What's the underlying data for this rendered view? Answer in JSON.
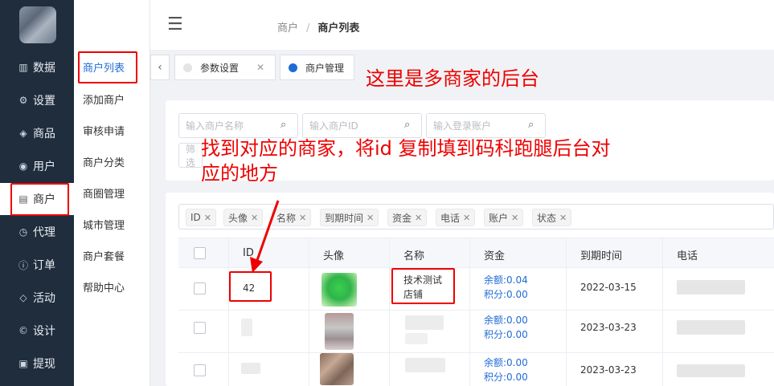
{
  "nav": {
    "items": [
      {
        "label": "数据",
        "icon": "bar-chart-icon"
      },
      {
        "label": "设置",
        "icon": "gear-icon"
      },
      {
        "label": "商品",
        "icon": "cube-icon"
      },
      {
        "label": "用户",
        "icon": "user-icon"
      },
      {
        "label": "商户",
        "icon": "list-icon"
      },
      {
        "label": "代理",
        "icon": "clock-icon"
      },
      {
        "label": "订单",
        "icon": "info-icon"
      },
      {
        "label": "活动",
        "icon": "tag-icon"
      },
      {
        "label": "设计",
        "icon": "copyright-icon"
      },
      {
        "label": "提现",
        "icon": "wallet-icon"
      }
    ]
  },
  "subnav": {
    "items": [
      "商户列表",
      "添加商户",
      "审核申请",
      "商户分类",
      "商圈管理",
      "城市管理",
      "商户套餐",
      "帮助中心"
    ]
  },
  "header": {
    "breadcrumb": [
      "商户",
      "商户列表"
    ],
    "separator": "/"
  },
  "tabs": [
    {
      "label": "参数设置",
      "dot_color": "#e4e4e4"
    },
    {
      "label": "商户管理",
      "dot_color": "#1e6bd6"
    }
  ],
  "filters": {
    "name_placeholder": "输入商户名称",
    "id_placeholder": "输入商户ID",
    "account_placeholder": "输入登录账户",
    "select_placeholder": "筛选"
  },
  "column_tags": [
    "ID",
    "头像",
    "名称",
    "到期时间",
    "资金",
    "电话",
    "账户",
    "状态"
  ],
  "table": {
    "headers": [
      "ID",
      "头像",
      "名称",
      "资金",
      "到期时间",
      "电话"
    ],
    "rows": [
      {
        "id": "42",
        "name_line1": "技术测试",
        "name_line2": "店铺",
        "balance": "余额:0.04",
        "points": "积分:0.00",
        "expire": "2022-03-15"
      },
      {
        "id": "",
        "name_line1": "",
        "name_line2": "",
        "balance": "余额:0.00",
        "points": "积分:0.00",
        "expire": "2023-03-23"
      },
      {
        "id": "",
        "name_line1": "",
        "name_line2": "",
        "balance": "余额:0.00",
        "points": "积分:0.00",
        "expire": "2023-03-23"
      }
    ]
  },
  "annotations": {
    "note1": "这里是多商家的后台",
    "note2_line1": "找到对应的商家，将id 复制填到码科跑腿后台对",
    "note2_line2": "应的地方"
  },
  "colors": {
    "sidebar_bg": "#1f2d3d",
    "accent": "#1e6bd6",
    "annotation": "#e00000"
  }
}
